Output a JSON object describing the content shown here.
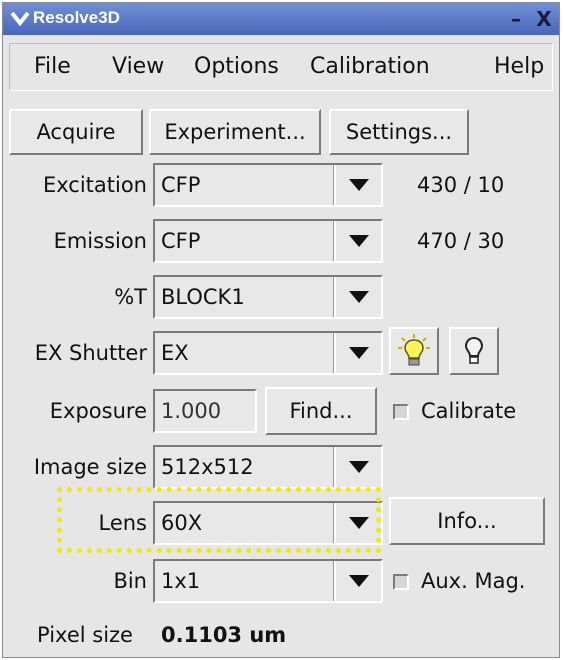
{
  "window": {
    "title": "Resolve3D",
    "minimize_symbol": "–",
    "close_symbol": "X"
  },
  "menubar": {
    "file": "File",
    "view": "View",
    "options": "Options",
    "calibration": "Calibration",
    "help": "Help"
  },
  "toolbar": {
    "acquire": "Acquire",
    "experiment": "Experiment...",
    "settings": "Settings..."
  },
  "form": {
    "excitation": {
      "label": "Excitation",
      "value": "CFP",
      "readout": "430 / 10"
    },
    "emission": {
      "label": "Emission",
      "value": "CFP",
      "readout": "470 / 30"
    },
    "percent_t": {
      "label": "%T",
      "value": "BLOCK1"
    },
    "ex_shutter": {
      "label": "EX Shutter",
      "value": "EX",
      "light_on_icon": "lightbulb-on-icon",
      "light_off_icon": "lightbulb-off-icon"
    },
    "exposure": {
      "label": "Exposure",
      "value": "1.000",
      "find_label": "Find...",
      "calibrate_label": "Calibrate",
      "calibrate_checked": false
    },
    "image_size": {
      "label": "Image size",
      "value": "512x512"
    },
    "lens": {
      "label": "Lens",
      "value": "60X",
      "info_label": "Info...",
      "highlight_color": "#f2ea00"
    },
    "bin": {
      "label": "Bin",
      "value": "1x1",
      "aux_mag_label": "Aux. Mag.",
      "aux_mag_checked": false
    },
    "pixel_size": {
      "label": "Pixel size",
      "value": "0.1103 um"
    }
  }
}
